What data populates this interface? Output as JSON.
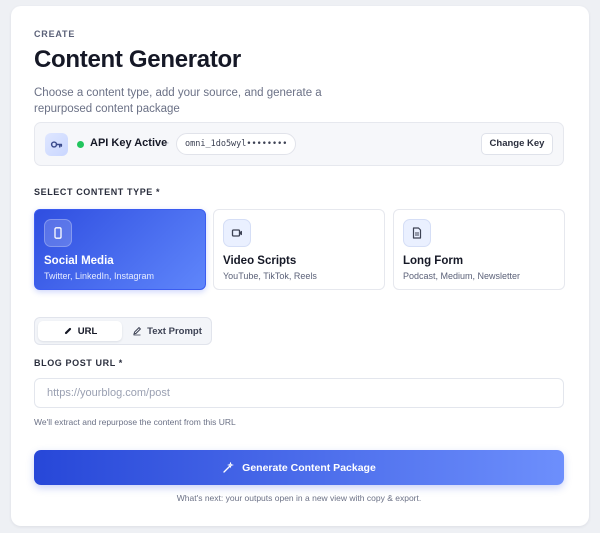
{
  "header": {
    "eyebrow": "CREATE",
    "title": "Content Generator",
    "subtitle": "Choose a content type, add your source, and generate a repurposed content package"
  },
  "api_key": {
    "status": "API Key Active",
    "separator": "·",
    "masked_key": "omni_1do5wyl••••••••",
    "change_label": "Change Key",
    "status_color": "#22c55e"
  },
  "content_type": {
    "label": "SELECT CONTENT TYPE *",
    "options": [
      {
        "name": "Social Media",
        "sub": "Twitter, LinkedIn, Instagram",
        "icon": "phone-icon",
        "selected": true
      },
      {
        "name": "Video Scripts",
        "sub": "YouTube, TikTok, Reels",
        "icon": "video-icon",
        "selected": false
      },
      {
        "name": "Long Form",
        "sub": "Podcast, Medium, Newsletter",
        "icon": "document-icon",
        "selected": false
      }
    ]
  },
  "source": {
    "tabs": [
      {
        "label": "URL",
        "icon": "link-icon",
        "selected": true
      },
      {
        "label": "Text Prompt",
        "icon": "pencil-icon",
        "selected": false
      }
    ],
    "field_label": "BLOG POST URL *",
    "placeholder": "https://yourblog.com/post",
    "value": "",
    "hint": "We'll extract and repurpose the content from this URL"
  },
  "actions": {
    "generate_label": "Generate Content Package",
    "generate_icon": "wand-icon",
    "footnote": "What's next: your outputs open in a new view with copy & export."
  },
  "colors": {
    "accent_start": "#2f4ee0",
    "accent_end": "#6d8ffc"
  }
}
